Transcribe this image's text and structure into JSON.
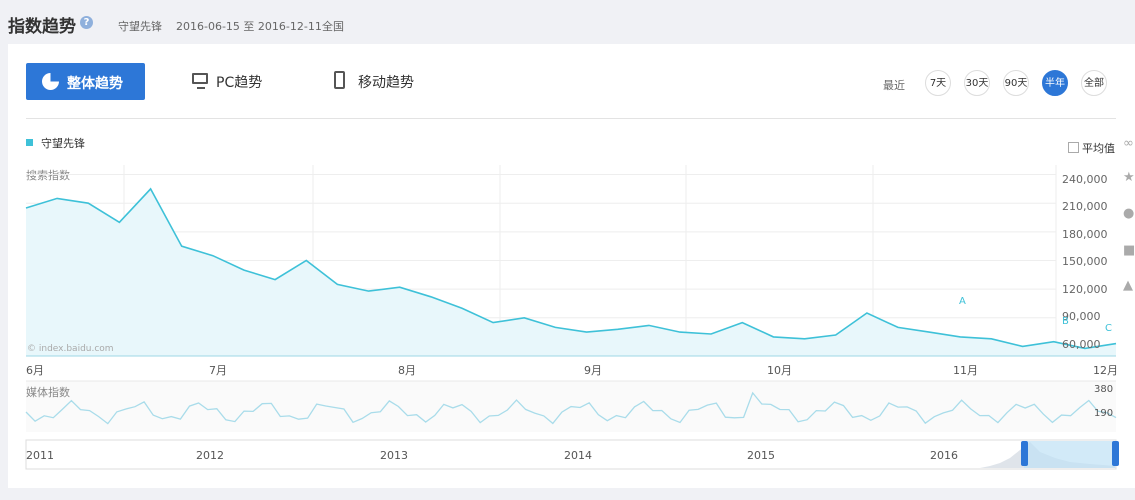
{
  "header": {
    "title": "指数趋势",
    "help_glyph": "?",
    "keyword": "守望先锋",
    "date_range": "2016-06-15 至 2016-12-11",
    "region": "全国"
  },
  "toolbar": {
    "overall_trend": "整体趋势",
    "pc_trend": "PC趋势",
    "mobile_trend": "移动趋势",
    "recent_label": "最近",
    "ranges": [
      {
        "label": "7天",
        "active": false
      },
      {
        "label": "30天",
        "active": false
      },
      {
        "label": "90天",
        "active": false
      },
      {
        "label": "半年",
        "active": true
      },
      {
        "label": "全部",
        "active": false
      }
    ]
  },
  "legend": {
    "series_name": "守望先锋",
    "avg_label": "平均值"
  },
  "chart": {
    "ylabel": "搜索指数",
    "yticks": [
      "240,000",
      "210,000",
      "180,000",
      "150,000",
      "120,000",
      "90,000",
      "60,000"
    ],
    "xticks": [
      "6月",
      "7月",
      "8月",
      "9月",
      "10月",
      "11月",
      "12月"
    ],
    "watermark": "© index.baidu.com",
    "events": [
      "A",
      "B",
      "C"
    ]
  },
  "media": {
    "label": "媒体指数",
    "yticks": [
      "380",
      "190"
    ]
  },
  "navigator": {
    "years": [
      "2011",
      "2012",
      "2013",
      "2014",
      "2015",
      "2016"
    ]
  },
  "colors": {
    "accent": "#2d77d7",
    "series": "#3ec1d8",
    "area": "#e8f7fb"
  },
  "chart_data": {
    "type": "area",
    "title": "搜索指数",
    "x": [
      "06-15",
      "06-20",
      "06-25",
      "07-01",
      "07-05",
      "07-10",
      "07-15",
      "07-20",
      "07-25",
      "08-01",
      "08-05",
      "08-10",
      "08-15",
      "08-20",
      "08-25",
      "09-01",
      "09-05",
      "09-10",
      "09-15",
      "09-20",
      "09-25",
      "10-01",
      "10-05",
      "10-10",
      "10-15",
      "10-20",
      "10-25",
      "11-01",
      "11-05",
      "11-10",
      "11-15",
      "11-20",
      "11-25",
      "12-01",
      "12-05",
      "12-11"
    ],
    "series": [
      {
        "name": "守望先锋",
        "values": [
          205000,
          215000,
          210000,
          190000,
          225000,
          165000,
          155000,
          140000,
          130000,
          150000,
          125000,
          118000,
          122000,
          112000,
          100000,
          85000,
          90000,
          80000,
          75000,
          78000,
          82000,
          75000,
          73000,
          85000,
          70000,
          68000,
          72000,
          95000,
          80000,
          75000,
          70000,
          68000,
          60000,
          65000,
          58000,
          63000
        ]
      }
    ],
    "ylim": [
      50000,
      250000
    ],
    "ylabel": "搜索指数",
    "grid": true,
    "legend": "top-left"
  }
}
